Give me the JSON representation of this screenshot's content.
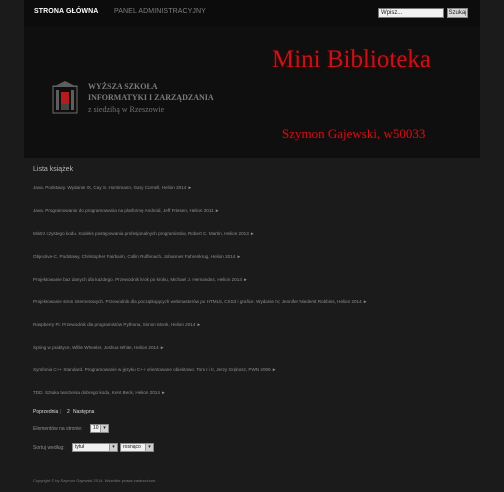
{
  "nav": {
    "home_label": "STRONA GŁÓWNA",
    "admin_label": "PANEL ADMINISTRACYJNY"
  },
  "search": {
    "placeholder": "Wpisz...",
    "button_label": "Szukaj"
  },
  "banner": {
    "school_line1": "WYŻSZA SZKOŁA",
    "school_line2": "INFORMATYKI I ZARZĄDZANIA",
    "school_line3": "z siedzibą w Rzeszowie",
    "site_title": "Mini Biblioteka",
    "author": "Szymon Gajewski, w50033"
  },
  "main": {
    "section_title": "Lista książek",
    "books": [
      "Java. Podstawy. Wydanie IX, Cay S. Horstmann, Gary Cornell, Helion 2014 ►",
      "Java. Programowanie do programowania na platformę Android, Jeff Friesen, Helion 2011 ►",
      "Mistrz czystego kodu. Kodeks postępowania profesjonalnych programistów, Robert C. Martin, Helion 2013 ►",
      "Objective-C. Podstawy, Christopher Fairbairn, Collin Ruffenach, Johannes Fahrenkrug, Helion 2014 ►",
      "Projektowanie baz danych dla każdego. Przewodnik krok po kroku, Michael J. Hernandez, Helion 2014 ►",
      "Projektowanie stron internetowych. Przewodnik dla początkujących webmasterów po HTML5, CSS3 i grafice. Wydanie IV, Jennifer Niederst Robbins, Helion 2014 ►",
      "Raspberry Pi. Przewodnik dla programistów Pythona, Simon Monk, Helion 2014 ►",
      "Spring w praktyce, Willie Wheeler, Joshua White, Helion 2014 ►",
      "Symfonia C++ Standard. Programowanie w języku C++ orientowane obiektowo. Tom I i II, Jerzy Grębosz, PWN 2006 ►",
      "TDD. Sztuka tworzenia dobrego kodu, Kent Beck, Helion 2014 ►"
    ],
    "pagination": {
      "prev": "Poprzednia",
      "separator": "|",
      "page": "2",
      "next": "Następna"
    },
    "per_page_label": "Elementów na stronie:",
    "per_page_value": "10",
    "sort_label": "Sortuj według:",
    "sort_field": "tytuł",
    "sort_order": "rosnąco"
  },
  "footer": {
    "copyright": "Copyright © by Szymon Gajewski 2014. Wszelkie prawa zastrzeżone."
  }
}
